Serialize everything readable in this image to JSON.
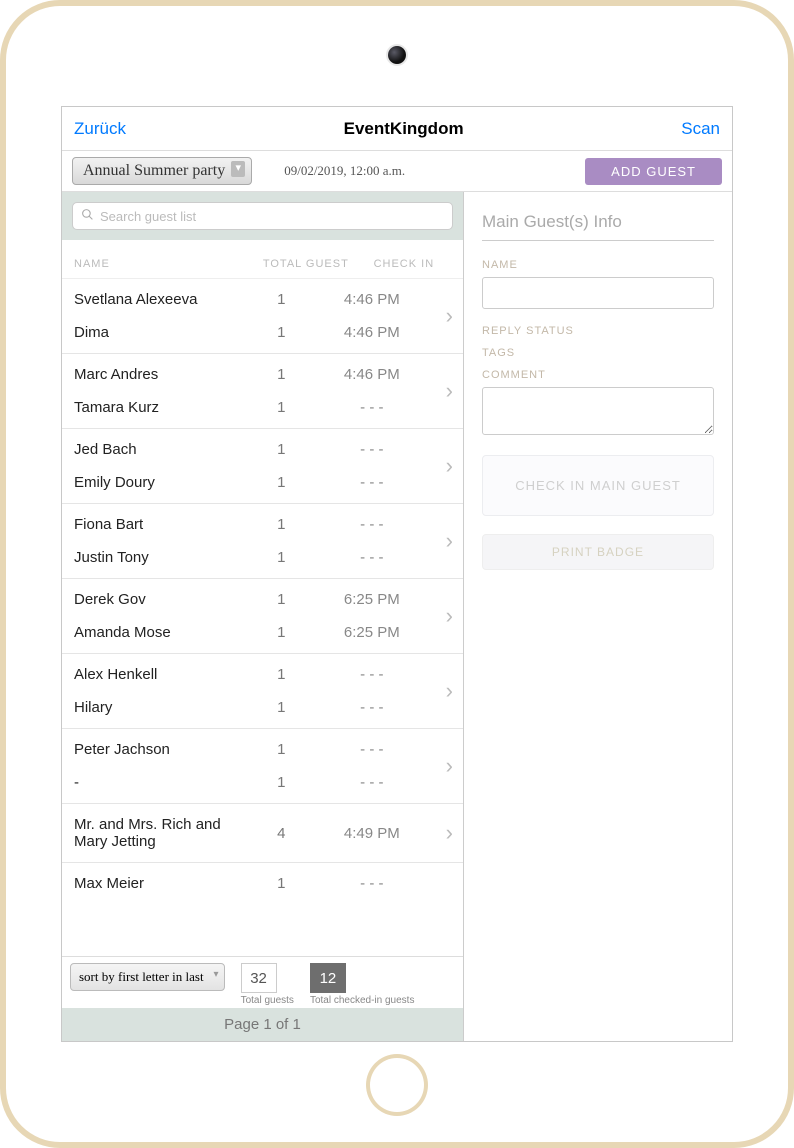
{
  "nav": {
    "back": "Zurück",
    "title": "EventKingdom",
    "scan": "Scan"
  },
  "toolbar": {
    "event_dropdown": "Annual Summer party",
    "date": "09/02/2019, 12:00 a.m.",
    "add_guest": "ADD GUEST"
  },
  "search": {
    "placeholder": "Search guest list"
  },
  "table": {
    "headers": {
      "name": "NAME",
      "total": "TOTAL GUEST",
      "check": "CHECK IN"
    },
    "groups": [
      {
        "rows": [
          {
            "name": "Svetlana Alexeeva",
            "total": "1",
            "check": "4:46 PM"
          },
          {
            "name": "Dima",
            "total": "1",
            "check": "4:46 PM"
          }
        ]
      },
      {
        "rows": [
          {
            "name": "Marc Andres",
            "total": "1",
            "check": "4:46 PM"
          },
          {
            "name": "Tamara Kurz",
            "total": "1",
            "check": "- - -"
          }
        ]
      },
      {
        "rows": [
          {
            "name": "Jed Bach",
            "total": "1",
            "check": "- - -"
          },
          {
            "name": "Emily Doury",
            "total": "1",
            "check": "- - -"
          }
        ]
      },
      {
        "rows": [
          {
            "name": "Fiona Bart",
            "total": "1",
            "check": "- - -"
          },
          {
            "name": "Justin Tony",
            "total": "1",
            "check": "- - -"
          }
        ]
      },
      {
        "rows": [
          {
            "name": "Derek Gov",
            "total": "1",
            "check": "6:25 PM"
          },
          {
            "name": "Amanda Mose",
            "total": "1",
            "check": "6:25 PM"
          }
        ]
      },
      {
        "rows": [
          {
            "name": "Alex Henkell",
            "total": "1",
            "check": "- - -"
          },
          {
            "name": "Hilary",
            "total": "1",
            "check": "- - -"
          }
        ]
      },
      {
        "rows": [
          {
            "name": "Peter Jachson",
            "total": "1",
            "check": "- - -"
          },
          {
            "name": "-",
            "total": "1",
            "check": "- - -"
          }
        ]
      },
      {
        "rows": [
          {
            "name": "Mr. and Mrs. Rich and Mary Jetting",
            "total": "4",
            "check": "4:49 PM"
          }
        ]
      },
      {
        "rows": [
          {
            "name": "Max Meier",
            "total": "1",
            "check": "- - -"
          }
        ],
        "partial": true
      }
    ]
  },
  "footer": {
    "sort": "sort by first letter in last",
    "total_guests": {
      "num": "32",
      "label": "Total guests"
    },
    "checked_in": {
      "num": "12",
      "label": "Total checked-in guests"
    },
    "page": "Page 1 of 1"
  },
  "info": {
    "title": "Main Guest(s) Info",
    "name_label": "NAME",
    "reply_label": "REPLY STATUS",
    "tags_label": "TAGS",
    "comment_label": "COMMENT",
    "checkin_btn": "CHECK IN MAIN GUEST",
    "print_btn": "PRINT BADGE"
  }
}
